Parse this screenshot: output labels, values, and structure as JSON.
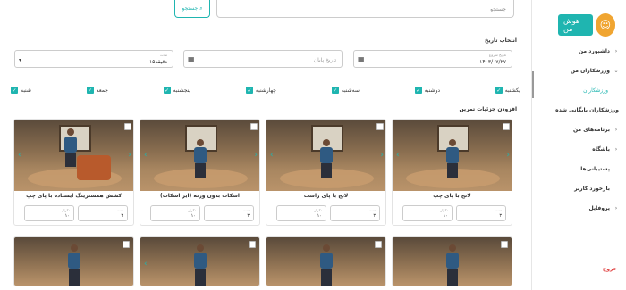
{
  "logo": {
    "text": "هوش من"
  },
  "sidebar": {
    "items": [
      {
        "label": "داشبورد من",
        "chev": "›"
      },
      {
        "label": "ورزشکاران من",
        "chev": "⌄"
      },
      {
        "label": "ورزشکاران",
        "chev": ""
      },
      {
        "label": "ورزشکاران بایگانی شده",
        "chev": ""
      },
      {
        "label": "برنامه‌های من",
        "chev": "›"
      },
      {
        "label": "باشگاه",
        "chev": "›"
      },
      {
        "label": "پشتیبانی‌ها",
        "chev": ""
      },
      {
        "label": "بازخورد کاربر",
        "chev": ""
      },
      {
        "label": "پروفایل",
        "chev": "›"
      }
    ],
    "logout": "خروج"
  },
  "search": {
    "placeholder": "جستجو",
    "button": "جستجو"
  },
  "date_section": {
    "title": "انتخاب تاریخ",
    "start_label": "تاریخ شروع",
    "start_value": "۱۴۰۳/۰۷/۲۷",
    "end_placeholder": "تاریخ پایان",
    "duration_label": "مدت",
    "duration_value": "۱۵دقیقه"
  },
  "days": [
    "یکشنبه",
    "دوشنبه",
    "سه‌شنبه",
    "چهارشنبه",
    "پنجشنبه",
    "جمعه",
    "شنبه"
  ],
  "exercises_title": "افزودن جزئیات تمرین",
  "cards": [
    {
      "title": "لانج با پای چپ",
      "sets_label": "ست",
      "sets": "۳",
      "reps_label": "تکرار",
      "reps": "۱۰"
    },
    {
      "title": "لانج با پای راست",
      "sets_label": "ست",
      "sets": "۳",
      "reps_label": "تکرار",
      "reps": "۱۰"
    },
    {
      "title": "اسکات بدون وزنه (ایر اسکات)",
      "sets_label": "ست",
      "sets": "۳",
      "reps_label": "تکرار",
      "reps": "۱۰"
    },
    {
      "title": "کشش همسترینگ ایستاده با پای چپ",
      "sets_label": "ست",
      "sets": "۳",
      "reps_label": "تکرار",
      "reps": "۱۰"
    }
  ],
  "colors": {
    "accent": "#1fb5b0",
    "logout": "#e04040",
    "logo": "#f0a531"
  }
}
